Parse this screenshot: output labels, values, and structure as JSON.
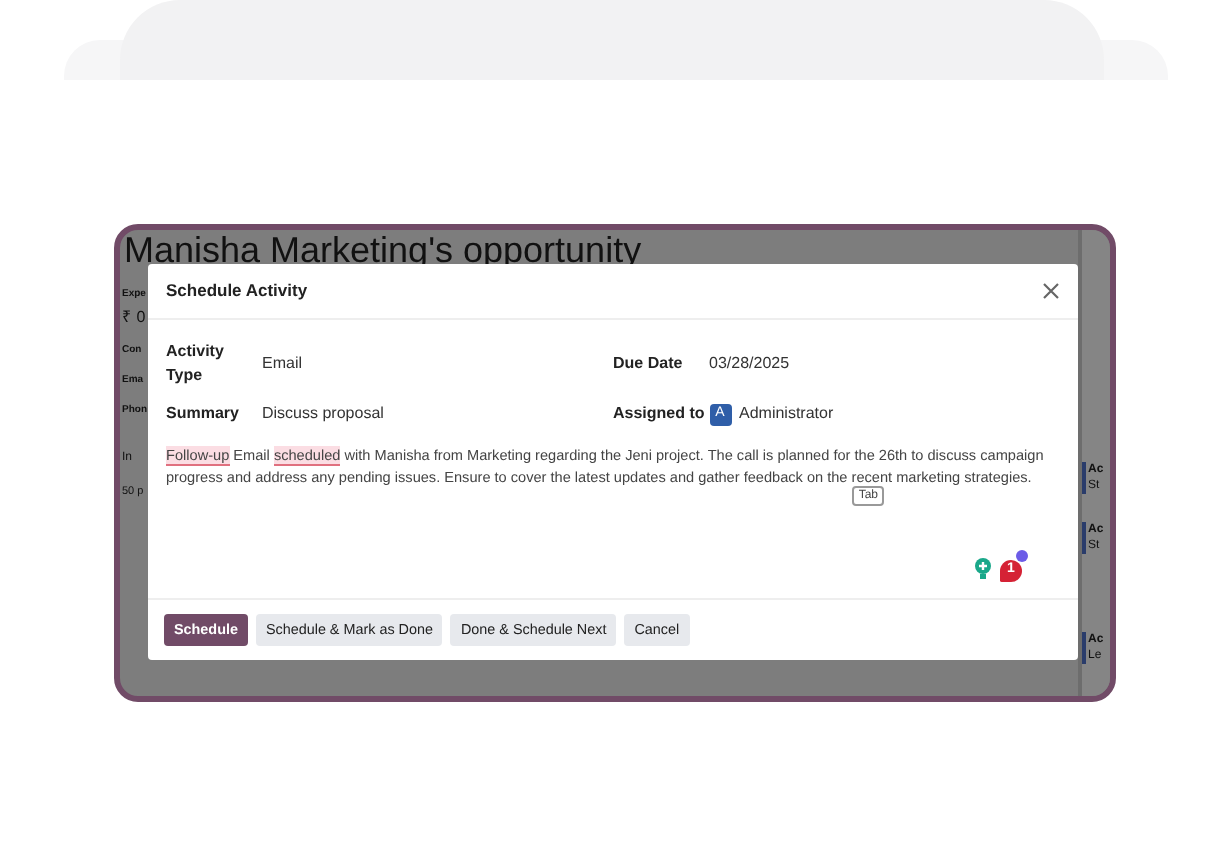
{
  "background_page": {
    "title": "Manisha Marketing's opportunity",
    "left_fragments": [
      {
        "text": "Expe",
        "kind": "label"
      },
      {
        "text": "₹ 0",
        "kind": "amount"
      },
      {
        "text": "Con",
        "kind": "label"
      },
      {
        "text": "Ema",
        "kind": "label"
      },
      {
        "text": "Phon",
        "kind": "label"
      },
      {
        "text": "In",
        "kind": "tab"
      },
      {
        "text": "50 p",
        "kind": "note"
      }
    ],
    "right_fragments": [
      {
        "title": "Ac",
        "subtitle": "St"
      },
      {
        "title": "Ac",
        "subtitle": "St"
      },
      {
        "title": "Ac",
        "subtitle": "Le"
      }
    ]
  },
  "dialog": {
    "title": "Schedule Activity",
    "fields": [
      {
        "label": "Activity Type",
        "value": "Email"
      },
      {
        "label": "Due Date",
        "value": "03/28/2025"
      },
      {
        "label": "Summary",
        "value": "Discuss proposal"
      },
      {
        "label": "Assigned to",
        "value": "Administrator",
        "avatar": "A"
      }
    ],
    "note": [
      {
        "text": "Follow-up",
        "flagged": true
      },
      {
        "text": " Email ",
        "flagged": false
      },
      {
        "text": "scheduled",
        "flagged": true
      },
      {
        "text": " with Manisha from Marketing regarding the Jeni project. The call is planned for the 26th to discuss campaign progress and address any pending issues. Ensure to cover the latest updates and gather feedback on the recent marketing strategies.",
        "flagged": false
      }
    ],
    "key_hint": "Tab",
    "alert_count": "1",
    "buttons": [
      {
        "label": "Schedule",
        "primary": true
      },
      {
        "label": "Schedule & Mark as Done",
        "primary": false
      },
      {
        "label": "Done & Schedule Next",
        "primary": false
      },
      {
        "label": "Cancel",
        "primary": false
      }
    ]
  }
}
